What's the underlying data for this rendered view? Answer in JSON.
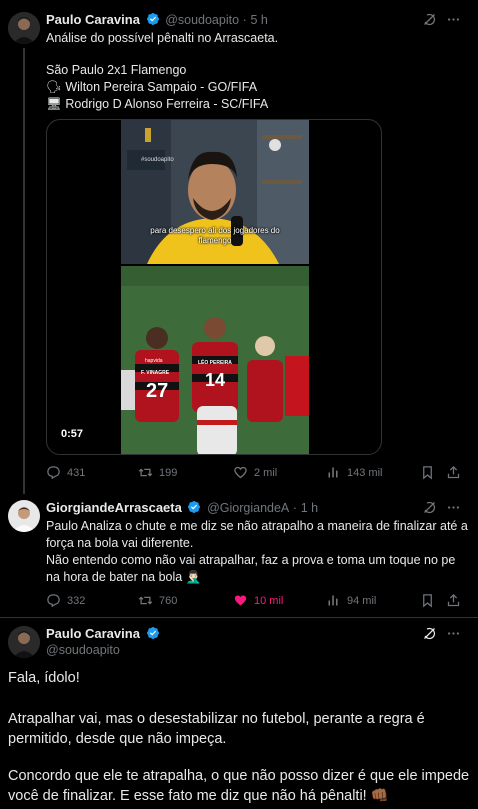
{
  "colors": {
    "background": "#000000",
    "text": "#e7e9ea",
    "muted": "#71767b",
    "verified": "#1d9bf0",
    "like_active": "#f91880"
  },
  "tweet1": {
    "author_name": "Paulo Caravina",
    "handle": "@soudoapito",
    "dot": "·",
    "time": "5 h",
    "lines": [
      "Análise do possível pênalti no Arrascaeta.",
      "São Paulo 2x1 Flamengo",
      "🗣 Wilton Pereira Sampaio - GO/FIFA",
      "🖥 Rodrigo D Alonso Ferreira - SC/FIFA"
    ],
    "video": {
      "duration": "0:57",
      "caption": "para desespero ali dos jogadores do flamengo",
      "watermark": "@SOUDOAPITO",
      "poster_label": "#soudoapito",
      "shirt_numbers": [
        "27",
        "14"
      ],
      "shirt_names": [
        "F. VINAGRE",
        "LÉO PEREIRA"
      ],
      "sponsor": "hapvida"
    },
    "actions": {
      "replies": "431",
      "reposts": "199",
      "likes": "2 mil",
      "views": "143 mil"
    }
  },
  "tweet2": {
    "author_name": "GiorgiandeArrascaeta",
    "handle": "@GiorgiandeA",
    "dot": "·",
    "time": "1 h",
    "lines": [
      "Paulo Analiza o chute e me diz se não atrapalho a maneira de finalizar até a",
      "força na bola vai diferente.",
      "Não entendo como não vai atrapalhar, faz a prova e toma um toque no pe",
      "na hora de bater na bola 🤦🏻‍♂️"
    ],
    "actions": {
      "replies": "332",
      "reposts": "760",
      "likes": "10 mil",
      "views": "94 mil"
    }
  },
  "tweet3": {
    "author_name": "Paulo Caravina",
    "handle": "@soudoapito",
    "lines": [
      "Fala, ídolo!",
      "Atrapalhar vai, mas o desestabilizar no futebol, perante a regra é",
      "permitido, desde que não impeça.",
      "Concordo que ele te atrapalha, o que não posso dizer é que ele impede",
      "você de finalizar. E esse fato me diz que não há pênalti! 👊🏾"
    ]
  }
}
